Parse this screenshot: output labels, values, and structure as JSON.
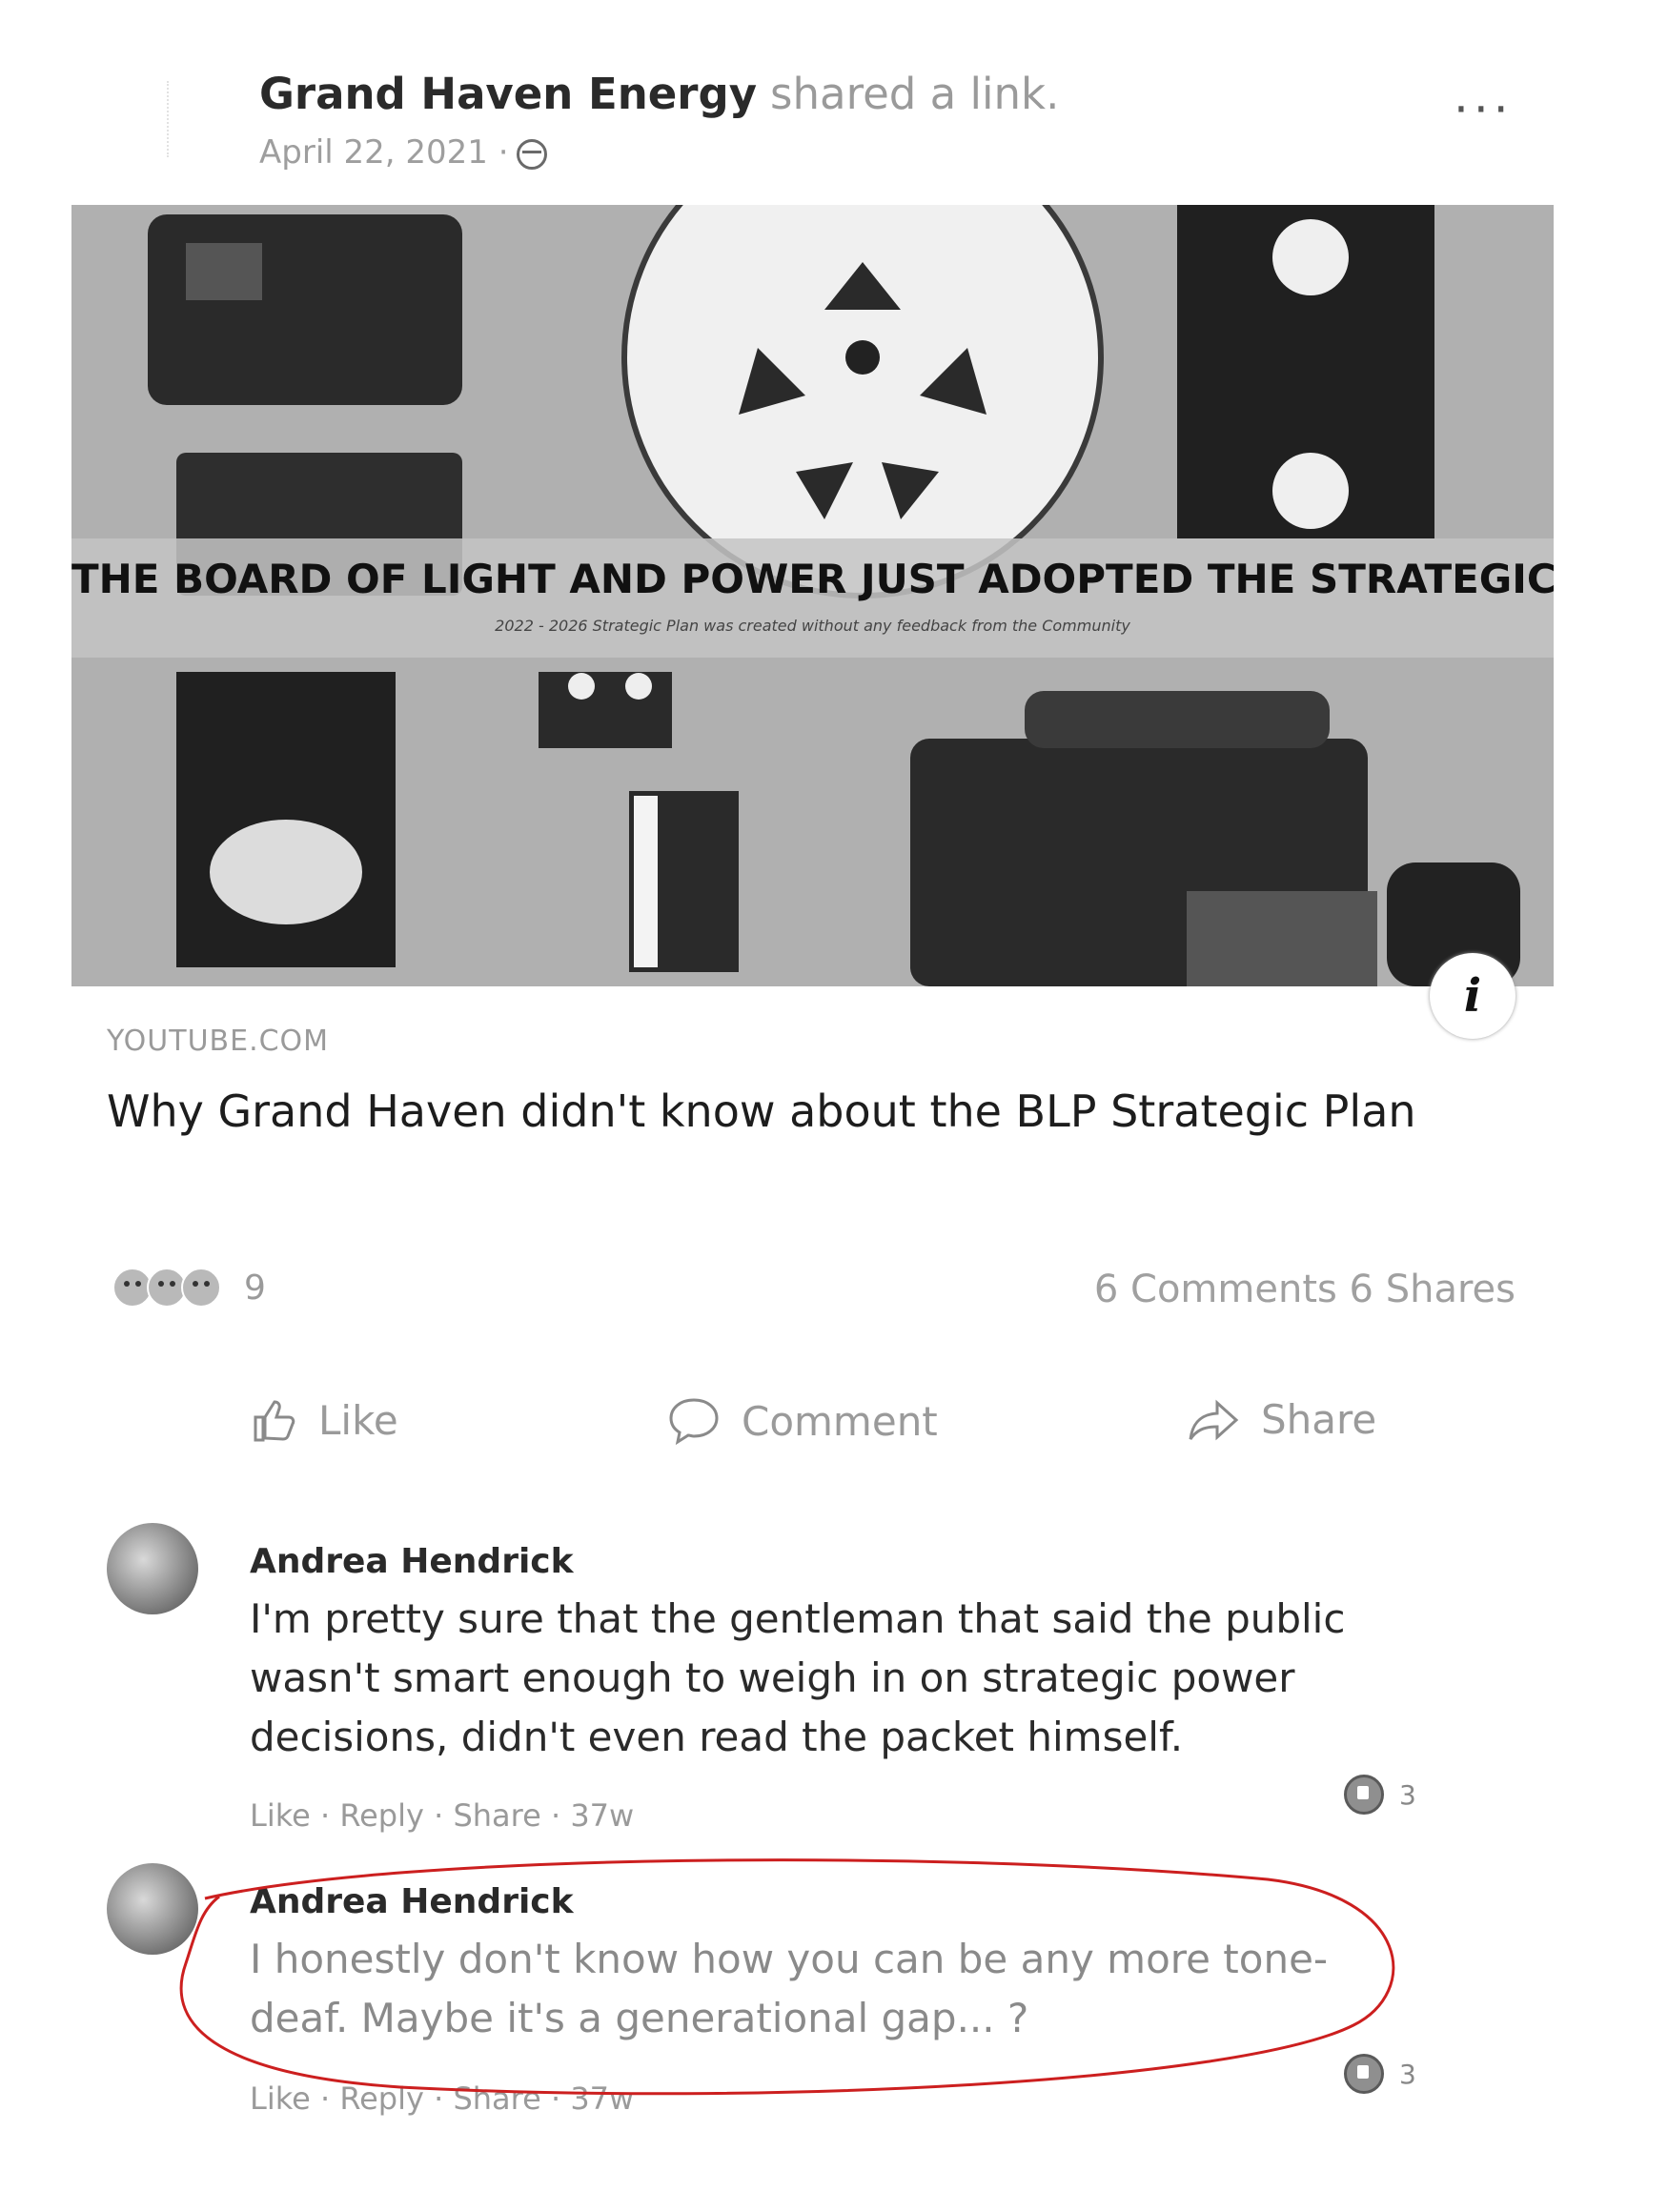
{
  "post": {
    "author": "Grand Haven Energy",
    "action": "shared a link.",
    "date": "April 22, 2021 ·",
    "more": "···"
  },
  "link": {
    "banner_title": "THE BOARD OF LIGHT AND POWER JUST ADOPTED THE STRATEGIC PLAN",
    "banner_subtitle": "2022 - 2026 Strategic Plan was created without any feedback from the Community",
    "info": "i",
    "source": "YOUTUBE.COM",
    "title": "Why Grand Haven didn't know about the BLP Strategic Plan"
  },
  "stats": {
    "reaction_count": "9",
    "comments_shares": "6 Comments  6 Shares"
  },
  "actions": {
    "like": "Like",
    "comment": "Comment",
    "share": "Share"
  },
  "comments": [
    {
      "author": "Andrea Hendrick",
      "text": "I'm pretty sure that the gentleman that said the public wasn't smart enough to weigh in on strategic power decisions, didn't even read the packet himself.",
      "meta": "Like · Reply · Share · 37w",
      "likes": "3"
    },
    {
      "author": "Andrea Hendrick",
      "text": "I honestly don't know how you can be any more tone-deaf. Maybe it's a generational gap... ?",
      "meta": "Like · Reply · Share · 37w",
      "likes": "3"
    }
  ],
  "colors": {
    "annotation": "#cc1f1f",
    "text": "#2a2a2a",
    "muted": "#9a9a9a"
  }
}
